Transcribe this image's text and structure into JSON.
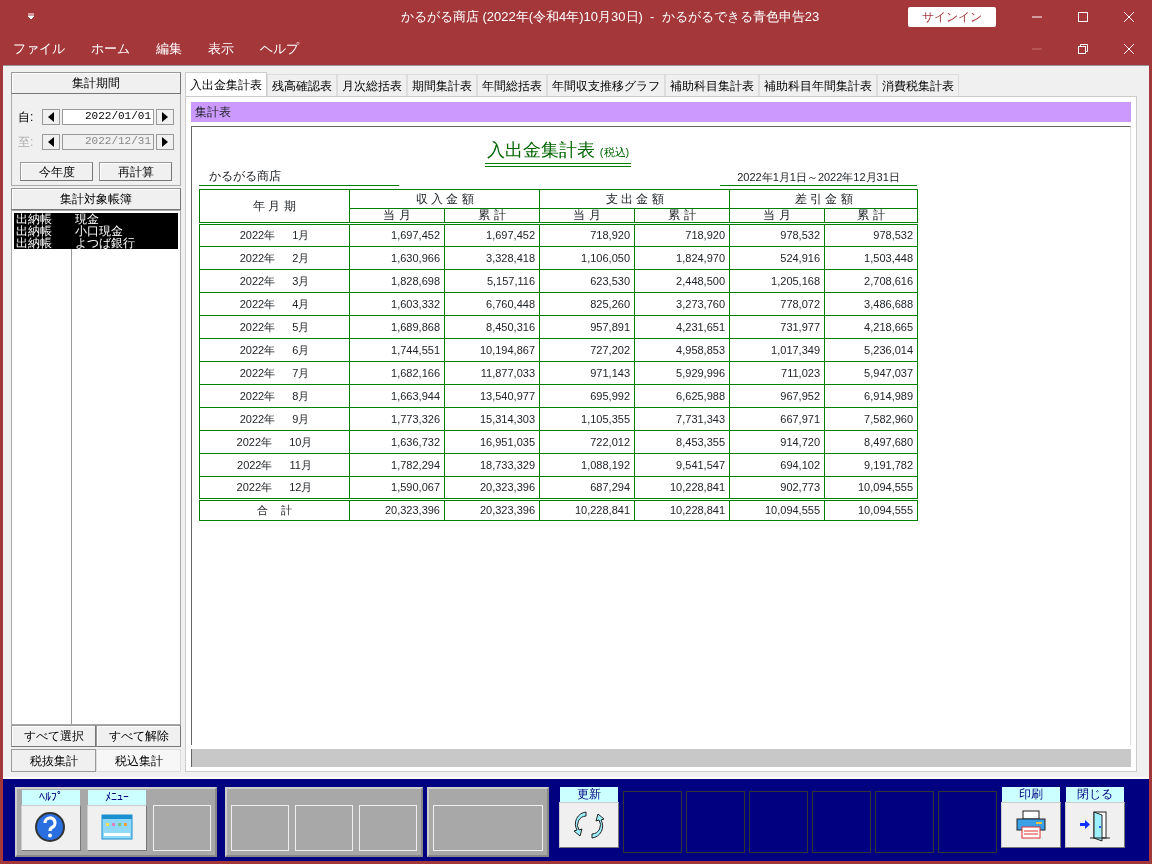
{
  "window": {
    "title": "かるがる商店 (2022年(令和4年)10月30日)  -  かるがるできる青色申告23",
    "signin": "サインイン"
  },
  "menu": [
    "ファイル",
    "ホーム",
    "編集",
    "表示",
    "ヘルプ"
  ],
  "sidebar": {
    "period_header": "集計期間",
    "dates": [
      {
        "label": "自:",
        "value": "2022/01/01",
        "disabled": false
      },
      {
        "label": "至:",
        "value": "2022/12/31",
        "disabled": true
      }
    ],
    "period_buttons": [
      "今年度",
      "再計算"
    ],
    "ledger_header": "集計対象帳簿",
    "ledgers": [
      {
        "type": "出納帳",
        "name": "現金",
        "selected": true
      },
      {
        "type": "出納帳",
        "name": "小口現金",
        "selected": true
      },
      {
        "type": "出納帳",
        "name": "よつば銀行",
        "selected": true
      }
    ],
    "select_buttons": [
      "すべて選択",
      "すべて解除"
    ],
    "tax_tabs": [
      {
        "label": "税抜集計",
        "selected": false
      },
      {
        "label": "税込集計",
        "selected": true
      }
    ]
  },
  "tabs": [
    {
      "label": "入出金集計表",
      "selected": true
    },
    {
      "label": "残高確認表",
      "selected": false
    },
    {
      "label": "月次総括表",
      "selected": false
    },
    {
      "label": "期間集計表",
      "selected": false
    },
    {
      "label": "年間総括表",
      "selected": false
    },
    {
      "label": "年間収支推移グラフ",
      "selected": false
    },
    {
      "label": "補助科目集計表",
      "selected": false
    },
    {
      "label": "補助科目年間集計表",
      "selected": false
    },
    {
      "label": "消費税集計表",
      "selected": false
    }
  ],
  "section_title": "集計表",
  "report": {
    "title": "入出金集計表",
    "title_note": "(税込)",
    "company": "かるがる商店",
    "period": "2022年1月1日～2022年12月31日",
    "header_period": "年 月 期",
    "groups": [
      "収 入 金 額",
      "支 出 金 額",
      "差 引 金 額"
    ],
    "subheads": [
      "当 月",
      "累 計",
      "当 月",
      "累 計",
      "当 月",
      "累 計"
    ],
    "rows": [
      [
        "2022年 1月",
        "1,697,452",
        "1,697,452",
        "718,920",
        "718,920",
        "978,532",
        "978,532"
      ],
      [
        "2022年 2月",
        "1,630,966",
        "3,328,418",
        "1,106,050",
        "1,824,970",
        "524,916",
        "1,503,448"
      ],
      [
        "2022年 3月",
        "1,828,698",
        "5,157,116",
        "623,530",
        "2,448,500",
        "1,205,168",
        "2,708,616"
      ],
      [
        "2022年 4月",
        "1,603,332",
        "6,760,448",
        "825,260",
        "3,273,760",
        "778,072",
        "3,486,688"
      ],
      [
        "2022年 5月",
        "1,689,868",
        "8,450,316",
        "957,891",
        "4,231,651",
        "731,977",
        "4,218,665"
      ],
      [
        "2022年 6月",
        "1,744,551",
        "10,194,867",
        "727,202",
        "4,958,853",
        "1,017,349",
        "5,236,014"
      ],
      [
        "2022年 7月",
        "1,682,166",
        "11,877,033",
        "971,143",
        "5,929,996",
        "711,023",
        "5,947,037"
      ],
      [
        "2022年 8月",
        "1,663,944",
        "13,540,977",
        "695,992",
        "6,625,988",
        "967,952",
        "6,914,989"
      ],
      [
        "2022年 9月",
        "1,773,326",
        "15,314,303",
        "1,105,355",
        "7,731,343",
        "667,971",
        "7,582,960"
      ],
      [
        "2022年 10月",
        "1,636,732",
        "16,951,035",
        "722,012",
        "8,453,355",
        "914,720",
        "8,497,680"
      ],
      [
        "2022年 11月",
        "1,782,294",
        "18,733,329",
        "1,088,192",
        "9,541,547",
        "694,102",
        "9,191,782"
      ],
      [
        "2022年 12月",
        "1,590,067",
        "20,323,396",
        "687,294",
        "10,228,841",
        "902,773",
        "10,094,555"
      ]
    ],
    "total": [
      "合 計",
      "20,323,396",
      "20,323,396",
      "10,228,841",
      "10,228,841",
      "10,094,555",
      "10,094,555"
    ]
  },
  "toolbar": [
    {
      "kind": "panel",
      "slots": [
        {
          "kind": "help",
          "label": "ﾍﾙﾌﾟ"
        },
        {
          "kind": "menu",
          "label": "ﾒﾆｭｰ"
        },
        {
          "kind": "empty"
        }
      ]
    },
    {
      "kind": "panel",
      "slots": [
        {
          "kind": "empty"
        },
        {
          "kind": "empty"
        },
        {
          "kind": "empty"
        }
      ]
    },
    {
      "kind": "panel",
      "slots": [
        {
          "kind": "wide"
        }
      ]
    },
    {
      "kind": "refresh",
      "label": "更新"
    },
    {
      "kind": "blank"
    },
    {
      "kind": "blank"
    },
    {
      "kind": "blank"
    },
    {
      "kind": "blank"
    },
    {
      "kind": "blank"
    },
    {
      "kind": "blank"
    },
    {
      "kind": "print",
      "label": "印刷"
    },
    {
      "kind": "exit",
      "label": "閉じる"
    }
  ]
}
